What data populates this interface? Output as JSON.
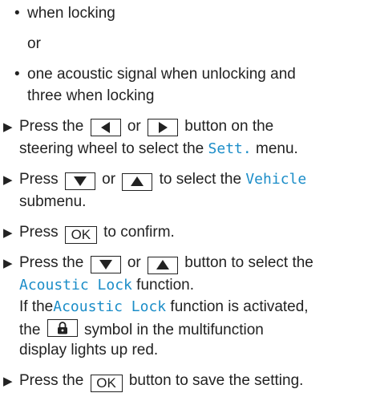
{
  "items": {
    "b1": "when locking",
    "or": "or",
    "b2_l1": "one acoustic signal when unlocking and",
    "b2_l2": "three when locking",
    "s1_l1_a": "Press the",
    "s1_l1_b": "or",
    "s1_l1_c": "button on the",
    "s1_l2_a": "steering wheel to select the",
    "s1_l2_menu": "Sett.",
    "s1_l2_b": "menu.",
    "s2_l1_a": "Press",
    "s2_l1_b": "or",
    "s2_l1_c": "to select the",
    "s2_l1_menu": "Vehicle",
    "s2_l2": "submenu.",
    "s3_a": "Press",
    "s3_key": "OK",
    "s3_b": "to confirm.",
    "s4_l1_a": "Press the",
    "s4_l1_b": "or",
    "s4_l1_c": "button to select the",
    "s4_l2_fn": "Acoustic Lock",
    "s4_l2_b": "function.",
    "s4_l3_a": "If the",
    "s4_l3_fn": "Acoustic Lock",
    "s4_l3_b": "function is activated,",
    "s4_l4_a": "the",
    "s4_l4_b": "symbol in the multifunction",
    "s4_l5": "display lights up red.",
    "s5_a": "Press the",
    "s5_key": "OK",
    "s5_b": "button to save the setting."
  },
  "icons": {
    "bullet": "bullet-dot",
    "step": "black-right-triangle",
    "left": "left-arrow-button",
    "right": "right-arrow-button",
    "down": "down-arrow-button",
    "up": "up-arrow-button",
    "lock": "padlock-icon"
  },
  "colors": {
    "highlight": "#1b8dc8",
    "text": "#222222"
  }
}
